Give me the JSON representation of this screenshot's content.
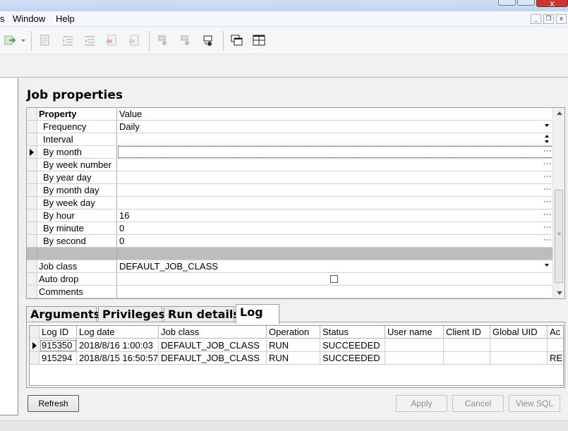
{
  "menubar": {
    "items": [
      "s",
      "Window",
      "Help"
    ]
  },
  "title": "Job properties",
  "property_grid": {
    "header": {
      "property": "Property",
      "value": "Value"
    },
    "rows": [
      {
        "name": "Frequency",
        "value": "Daily"
      },
      {
        "name": "Interval",
        "value": ""
      },
      {
        "name": "By month",
        "value": ""
      },
      {
        "name": "By week number",
        "value": ""
      },
      {
        "name": "By year day",
        "value": ""
      },
      {
        "name": "By month day",
        "value": ""
      },
      {
        "name": "By week day",
        "value": ""
      },
      {
        "name": "By hour",
        "value": "16"
      },
      {
        "name": "By minute",
        "value": "0"
      },
      {
        "name": "By second",
        "value": "0"
      },
      {
        "name": "",
        "value": ""
      },
      {
        "name": "Job class",
        "value": "DEFAULT_JOB_CLASS"
      },
      {
        "name": "Auto drop",
        "value": ""
      },
      {
        "name": "Comments",
        "value": ""
      }
    ],
    "auto_drop_checked": false,
    "ellipsis": "···"
  },
  "tabs": [
    "Arguments",
    "Privileges",
    "Run details",
    "Log"
  ],
  "active_tab": "Log",
  "log": {
    "columns": [
      "Log ID",
      "Log date",
      "Job class",
      "Operation",
      "Status",
      "User name",
      "Client ID",
      "Global UID",
      "Ac"
    ],
    "rows": [
      [
        "915350",
        "2018/8/16 1:00:03",
        "DEFAULT_JOB_CLASS",
        "RUN",
        "SUCCEEDED",
        "",
        "",
        "",
        ""
      ],
      [
        "915294",
        "2018/8/15 16:50:57",
        "DEFAULT_JOB_CLASS",
        "RUN",
        "SUCCEEDED",
        "",
        "",
        "",
        "RE"
      ]
    ]
  },
  "buttons": {
    "refresh": "Refresh",
    "apply": "Apply",
    "cancel": "Cancel",
    "view_sql": "View SQL"
  },
  "window_controls": {
    "minimize": "_",
    "restore": "❐",
    "close": "x"
  },
  "toolbar_icons": [
    "export-icon",
    "page-icon",
    "indent-icon",
    "outdent-icon",
    "remove-page-icon",
    "restore-page-icon",
    "job-icon",
    "job-disabled-icon",
    "job-run-icon",
    "cascade-windows-icon",
    "tile-windows-icon"
  ],
  "colors": {
    "selection_outline": "#333333",
    "separator_row": "#bdbdbd"
  }
}
